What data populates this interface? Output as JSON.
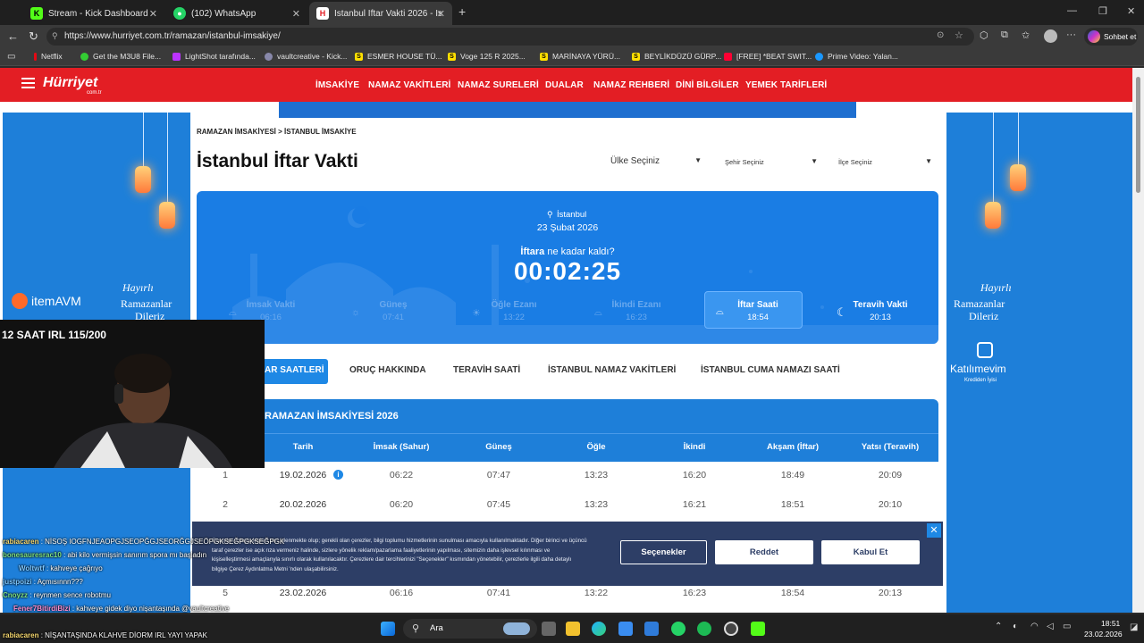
{
  "browser": {
    "tabs": [
      {
        "title": "Stream - Kick Dashboard",
        "icon": "kick-icon"
      },
      {
        "title": "(102) WhatsApp",
        "icon": "whatsapp-icon"
      },
      {
        "title": "İstanbul İftar Vakti 2026 - İstanbul",
        "icon": "hurriyet-icon"
      }
    ],
    "url": "https://www.hurriyet.com.tr/ramazan/istanbul-imsakiye/",
    "copilot": "Sohbet et",
    "bookmarks": [
      "Netflix",
      "Get the M3U8 File...",
      "LightShot tarafında...",
      "vaultcreative - Kick...",
      "ESMER HOUSE TÜ...",
      "Voge 125 R 2025...",
      "MARİNAYA YÜRÜ...",
      "BEYLİKDÜZÜ GÜRP...",
      "[FREE] *BEAT SWIT...",
      "Prime Video: Yalan..."
    ]
  },
  "site": {
    "logo": "Hürriyet",
    "logo_sub": "com.tr",
    "nav": [
      "İMSAKİYE",
      "NAMAZ VAKİTLERİ",
      "NAMAZ SURELERİ",
      "DUALAR",
      "NAMAZ REHBERİ",
      "DİNİ BİLGİLER",
      "YEMEK TARİFLERİ"
    ]
  },
  "page": {
    "breadcrumb": "RAMAZAN İMSAKİYESİ > İSTANBUL İMSAKİYE",
    "title": "İstanbul İftar Vakti",
    "selects": {
      "country": "Ülke Seçiniz",
      "city": "Şehir Seçiniz",
      "district": "İlçe Seçiniz"
    },
    "hero": {
      "city": "İstanbul",
      "date": "23 Şubat 2026",
      "question_bold": "İftara",
      "question_rest": " ne kadar kaldı?",
      "countdown": "00:02:25",
      "times": [
        {
          "name": "İmsak Vakti",
          "time": "06:16"
        },
        {
          "name": "Güneş",
          "time": "07:41"
        },
        {
          "name": "Öğle Ezanı",
          "time": "13:22"
        },
        {
          "name": "İkindi Ezanı",
          "time": "16:23"
        },
        {
          "name": "İftar Saati",
          "time": "18:54"
        },
        {
          "name": "Teravih Vakti",
          "time": "20:13"
        }
      ]
    },
    "tabs": [
      "AR SAATLERİ",
      "ORUÇ HAKKINDA",
      "TERAVİH SAATİ",
      "İSTANBUL NAMAZ VAKİTLERİ",
      "İSTANBUL CUMA NAMAZI SAATİ"
    ],
    "table_title": "RAMAZAN İMSAKİYESİ 2026",
    "table_headers": [
      "Tarih",
      "İmsak (Sahur)",
      "Güneş",
      "Öğle",
      "İkindi",
      "Akşam (İftar)",
      "Yatsı (Teravih)"
    ],
    "rows": [
      [
        "1",
        "19.02.2026",
        "06:22",
        "07:47",
        "13:23",
        "16:20",
        "18:49",
        "20:09"
      ],
      [
        "2",
        "20.02.2026",
        "06:20",
        "07:45",
        "13:23",
        "16:21",
        "18:51",
        "20:10"
      ],
      [
        "5",
        "23.02.2026",
        "06:16",
        "07:41",
        "13:22",
        "16:23",
        "18:54",
        "20:13"
      ]
    ]
  },
  "ads": {
    "left_brand": "itemAVM",
    "greeting_1": "Hayırlı",
    "greeting_2": "Ramazanlar",
    "greeting_3": "Dileriz",
    "right_brand": "Katılımevim",
    "right_tagline": "Krediden İyisi"
  },
  "cookie": {
    "text": "Çerezler yoluyla kişisel veri işlenmekte olup; gerekli olan çerezler, bilgi toplumu hizmetlerinin sunulması amacıyla kullanılmaktadır. Diğer birinci ve üçüncü taraf çerezler ise açık rıza vermeniz halinde, sizlere yönelik reklam/pazarlama faaliyetlerinin yapılması, sitemizin daha işlevsel kılınması ve kişiselleştirmesi amaçlarıyla sınırlı olarak kullanılacaktır. Çerezlere dair tercihlerinizi \"Seçenekler\" kısmından yönetebilir, çerezlerle ilgili daha detaylı bilgiye Çerez Aydınlatma Metni 'nden ulaşabilirsiniz.",
    "options": "Seçenekler",
    "reject": "Reddet",
    "accept": "Kabul Et"
  },
  "stream": {
    "overlay": "12 SAAT IRL 115/200",
    "chat": [
      {
        "user": "rabiacaren",
        "msg": ": NİSOŞ IOGFNJEAOPGJSEOPĞGJSEORĞGJSEÖPGKSEĞPGKSEĞPGK",
        "color": "#f5d76e"
      },
      {
        "user": "bonesauresrac10",
        "msg": ": abi kilo vermişsin sanırım spora mı başladın",
        "color": "#7ee081"
      },
      {
        "user": "Woltwtf",
        "msg": ": kahveye çağrıyo",
        "color": "#7ec8ff"
      },
      {
        "user": "justpoizi",
        "msg": ": Açmısınnn???",
        "color": "#7ec8ff"
      },
      {
        "user": "Cnoyzz",
        "msg": ": reynmen sence robotmu",
        "color": "#7ee081"
      },
      {
        "user": "Fener7BitirdiBizi",
        "msg": ": kahveye gidek diyo nişantaşında @vaultcreative",
        "color": "#ff8fd0"
      },
      {
        "user": "taiburger",
        "msg": "",
        "color": "#ff9f6e"
      },
      {
        "user": "rabiacaren",
        "msg": ": NİŞANTAŞINDA KLAHVE DİORM IRL YAYI YAPAK",
        "color": "#f5d76e"
      }
    ]
  },
  "taskbar": {
    "search": "Ara",
    "time": "18:51",
    "date": "23.02.2026"
  },
  "colors": {
    "brand": "#e31e24",
    "hero": "#1a7de4",
    "accent": "#1e88e5"
  }
}
